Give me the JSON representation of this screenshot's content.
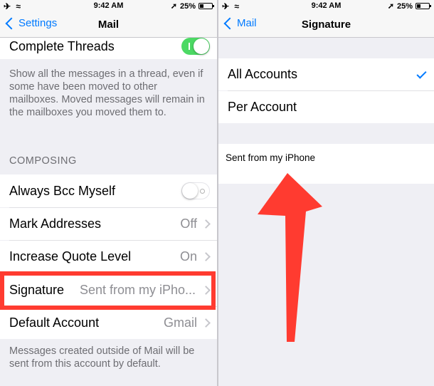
{
  "status_bar": {
    "time": "9:42 AM",
    "battery": "25%"
  },
  "left": {
    "back_label": "Settings",
    "title": "Mail",
    "complete_threads": {
      "label": "Complete Threads",
      "state": "on"
    },
    "threads_footer": "Show all the messages in a thread, even if some have been moved to other mailboxes. Moved messages will remain in the mailboxes you moved them to.",
    "composing_header": "COMPOSING",
    "always_bcc": {
      "label": "Always Bcc Myself",
      "state": "off"
    },
    "mark_addresses": {
      "label": "Mark Addresses",
      "value": "Off"
    },
    "increase_quote": {
      "label": "Increase Quote Level",
      "value": "On"
    },
    "signature": {
      "label": "Signature",
      "value": "Sent from my iPho..."
    },
    "default_account": {
      "label": "Default Account",
      "value": "Gmail"
    },
    "default_footer": "Messages created outside of Mail will be sent from this account by default."
  },
  "right": {
    "back_label": "Mail",
    "title": "Signature",
    "options": [
      "All Accounts",
      "Per Account"
    ],
    "selected_option": "All Accounts",
    "signature_text": "Sent from my iPhone"
  },
  "colors": {
    "ios_blue": "#007aff",
    "toggle_green": "#4cd964",
    "highlight_red": "#ff3b30",
    "grouped_background": "#efeff4"
  }
}
